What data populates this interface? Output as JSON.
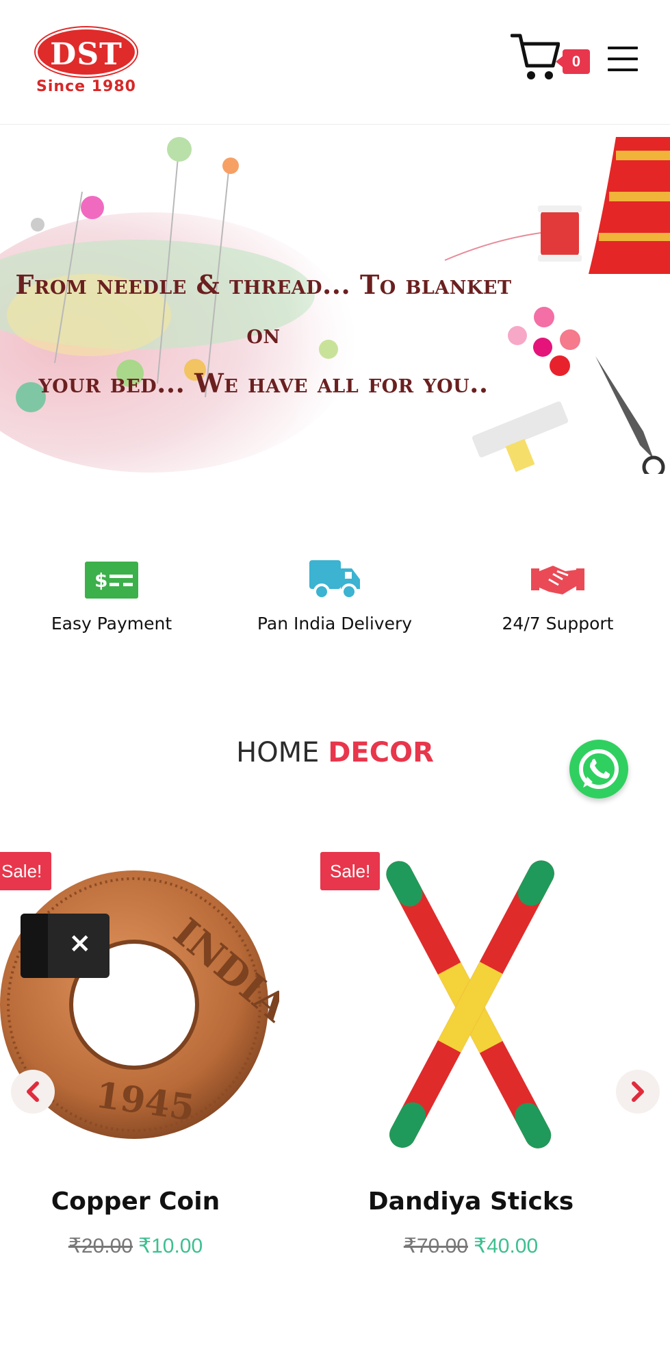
{
  "header": {
    "logo_text": "DST",
    "logo_since": "Since 1980",
    "cart_count": "0"
  },
  "banner": {
    "line1": "From needle & thread... To blanket on",
    "line2": "your bed... We have all for you.."
  },
  "features": [
    {
      "label": "Easy Payment",
      "icon": "payment-card-icon",
      "color": "#3cb04a"
    },
    {
      "label": "Pan India Delivery",
      "icon": "delivery-truck-icon",
      "color": "#3bb3d1"
    },
    {
      "label": "24/7 Support",
      "icon": "handshake-icon",
      "color": "#ea4a56"
    }
  ],
  "section": {
    "title_plain": "HOME",
    "title_accent": "DECOR"
  },
  "products": [
    {
      "name": "Copper Coin",
      "badge": "Sale!",
      "old_price": "₹20.00",
      "new_price": "₹10.00"
    },
    {
      "name": "Dandiya Sticks",
      "badge": "Sale!",
      "old_price": "₹70.00",
      "new_price": "₹40.00"
    }
  ],
  "popup": {
    "close_symbol": "×"
  },
  "colors": {
    "accent": "#e8364c",
    "price_green": "#3dbf8f",
    "whatsapp": "#2fd060"
  }
}
